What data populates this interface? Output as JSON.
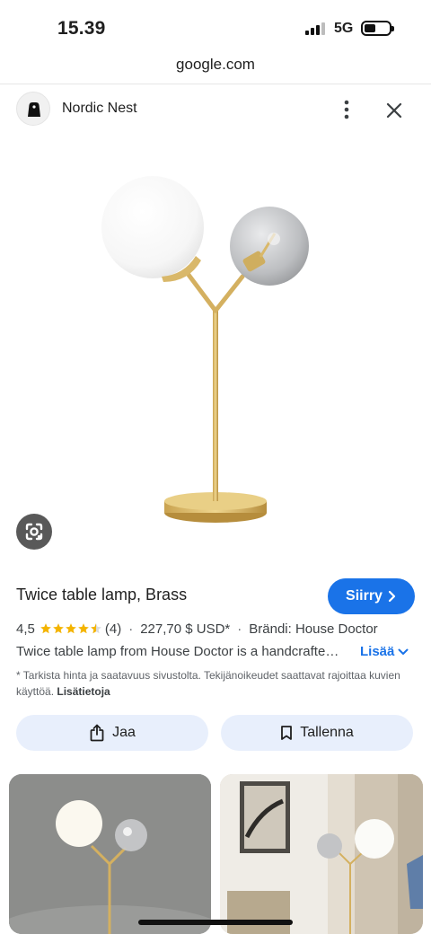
{
  "status_bar": {
    "time": "15.39",
    "network": "5G"
  },
  "browser": {
    "url": "google.com"
  },
  "source": {
    "name": "Nordic Nest",
    "more_icon": "more-vert-icon",
    "close_icon": "close-icon"
  },
  "product": {
    "title": "Twice table lamp, Brass",
    "rating": "4,5",
    "rating_stars": 4.5,
    "review_count": "(4)",
    "price": "227,70 $ USD*",
    "brand": "Brändi: House Doctor",
    "description": "Twice table lamp from House Doctor is a handcrafte…",
    "more_label": "Lisää",
    "disclaimer": "* Tarkista hinta ja saatavuus sivustolta. Tekijänoikeudet saattavat rajoittaa kuvien käyttöä.",
    "disclaimer_link": "Lisätietoja"
  },
  "buttons": {
    "visit": "Siirry",
    "share": "Jaa",
    "save": "Tallenna"
  },
  "colors": {
    "accent": "#1a73e8",
    "star": "#f4b400",
    "brass": "#d4b060",
    "pill_bg": "#e8effc"
  }
}
